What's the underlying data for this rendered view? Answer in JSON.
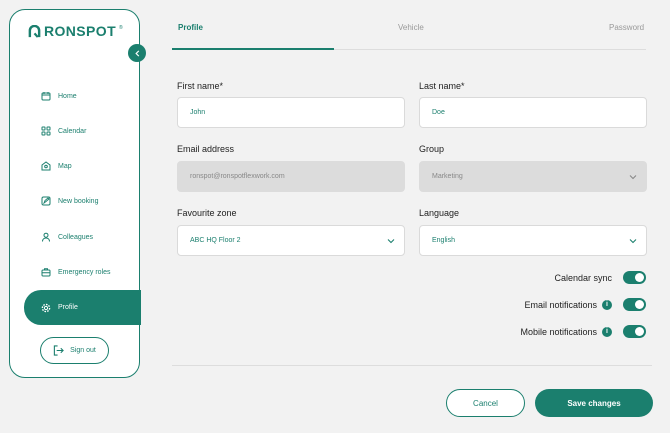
{
  "brand": {
    "name": "RONSPOT",
    "trademark": "®",
    "accent": "#1b7f6e"
  },
  "sidebar": {
    "items": [
      {
        "label": "Home",
        "icon": "calendar-day-icon"
      },
      {
        "label": "Calendar",
        "icon": "grid-icon"
      },
      {
        "label": "Map",
        "icon": "map-pin-icon"
      },
      {
        "label": "New booking",
        "icon": "edit-icon"
      },
      {
        "label": "Colleagues",
        "icon": "user-icon"
      },
      {
        "label": "Emergency roles",
        "icon": "briefcase-icon"
      },
      {
        "label": "Profile",
        "icon": "gear-icon",
        "active": true
      }
    ],
    "signout_label": "Sign out"
  },
  "tabs": [
    {
      "label": "Profile",
      "active": true
    },
    {
      "label": "Vehicle"
    },
    {
      "label": "Password"
    }
  ],
  "form": {
    "first_name": {
      "label": "First name*",
      "value": "John"
    },
    "last_name": {
      "label": "Last name*",
      "value": "Doe"
    },
    "email": {
      "label": "Email address",
      "value": "ronspot@ronspotflexwork.com"
    },
    "group": {
      "label": "Group",
      "value": "Marketing"
    },
    "zone": {
      "label": "Favourite zone",
      "value": "ABC HQ Floor 2"
    },
    "language": {
      "label": "Language",
      "value": "English"
    }
  },
  "toggles": [
    {
      "label": "Calendar sync",
      "on": true,
      "info": false
    },
    {
      "label": "Email notifications",
      "on": true,
      "info": true
    },
    {
      "label": "Mobile notifications",
      "on": true,
      "info": true
    }
  ],
  "actions": {
    "cancel_label": "Cancel",
    "save_label": "Save changes"
  }
}
